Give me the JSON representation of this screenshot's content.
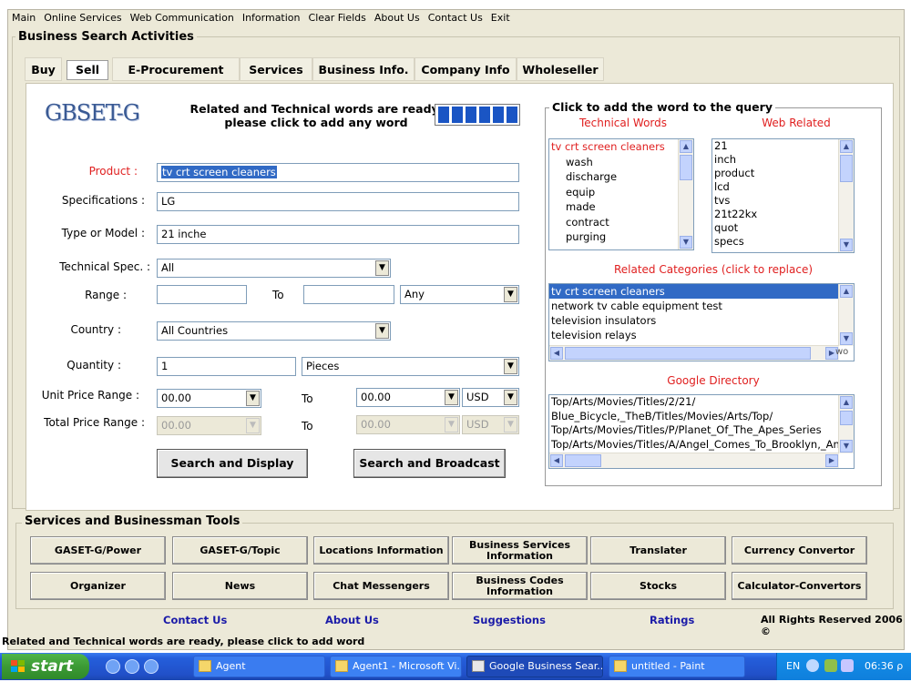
{
  "menu": [
    "Main",
    "Online Services",
    "Web Communication",
    "Information",
    "Clear Fields",
    "About Us",
    "Contact Us",
    "Exit"
  ],
  "group_title": "Business Search Activities",
  "tabs": [
    "Buy",
    "Sell",
    "E-Procurement",
    "Services",
    "Business Info.",
    "Company Info",
    "Wholeseller"
  ],
  "active_tab": "Sell",
  "logo": "GBSET-G",
  "ready_msg_line1": "Related and Technical words are ready,",
  "ready_msg_line2": "please click to add any word",
  "form": {
    "product_label": "Product :",
    "product_value": "tv crt screen cleaners",
    "spec_label": "Specifications :",
    "spec_value": "LG",
    "model_label": "Type or Model :",
    "model_value": "21 inche",
    "tech_label": "Technical Spec. :",
    "tech_value": "All",
    "range_label": "Range :",
    "range_to": "To",
    "range_unit": "Any",
    "country_label": "Country :",
    "country_value": "All Countries",
    "qty_label": "Quantity :",
    "qty_value": "1",
    "qty_unit": "Pieces",
    "unit_price_label": "Unit Price Range :",
    "unit_price_from": "00.00",
    "unit_price_to_label": "To",
    "unit_price_to": "00.00",
    "unit_currency": "USD",
    "total_price_label": "Total Price Range :",
    "total_price_from": "00.00",
    "total_price_to_label": "To",
    "total_price_to": "00.00",
    "total_currency": "USD"
  },
  "buttons": {
    "search_display": "Search and Display",
    "search_broadcast": "Search and  Broadcast"
  },
  "query_panel": {
    "title": "Click to add the word to the query",
    "tech_title": "Technical  Words",
    "web_title": "Web Related",
    "tech_words": [
      "tv crt screen cleaners",
      "wash",
      "discharge",
      "equip",
      "made",
      "contract",
      "purging"
    ],
    "web_words": [
      "21",
      "inch",
      "product",
      "lcd",
      "tvs",
      "21t22kx",
      "quot",
      "specs"
    ],
    "cat_title": "Related Categories (click to replace)",
    "categories": [
      "tv crt screen cleaners",
      "network tv cable equipment test",
      "television insulators",
      "television relays"
    ],
    "cat_scroll_tail": "wo",
    "dir_title": "Google Directory",
    "directory": [
      "Top/Arts/Movies/Titles/2/21/",
      "Blue_Bicycle,_TheB/Titles/Movies/Arts/Top/",
      "Top/Arts/Movies/Titles/P/Planet_Of_The_Apes_Series",
      "Top/Arts/Movies/Titles/A/Angel_Comes_To_Brooklyn,_An"
    ]
  },
  "tools": {
    "title": "Services and Businessman Tools",
    "row1": [
      "GASET-G/Power",
      "GASET-G/Topic",
      "Locations Information",
      "Business Services Information",
      "Translater",
      "Currency Convertor"
    ],
    "row2": [
      "Organizer",
      "News",
      "Chat Messengers",
      "Business Codes Information",
      "Stocks",
      "Calculator-Convertors"
    ]
  },
  "footer_links": [
    "Contact Us",
    "About Us",
    "Suggestions",
    "Ratings"
  ],
  "rights": "All Rights Reserved 2006 ©",
  "status": "Related and Technical words are ready, please click to add word",
  "taskbar": {
    "start": "start",
    "tasks": [
      "Agent",
      "Agent1 - Microsoft Vi...",
      "Google Business Sear...",
      "untitled - Paint"
    ],
    "lang": "EN",
    "time": "06:36 ρ"
  },
  "colors": {
    "accent_red": "#e02020",
    "link_blue": "#1a1aa8",
    "selection": "#316AC5",
    "chrome": "#ECE9D8"
  }
}
